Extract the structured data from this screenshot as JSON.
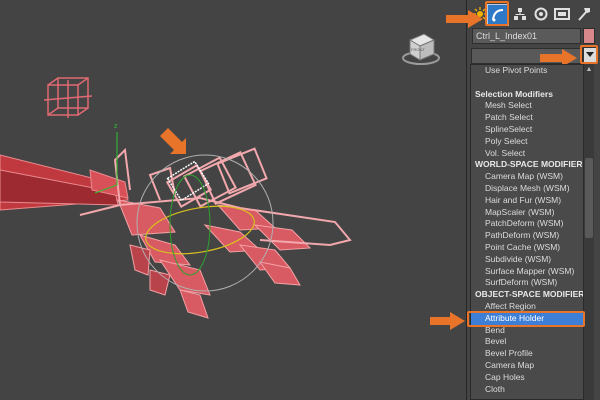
{
  "viewport": {
    "viewcube_label": "FRONT",
    "axis_z_label": "z"
  },
  "command_panel": {
    "tabs": [
      {
        "icon": "create-icon"
      },
      {
        "icon": "modify-icon"
      },
      {
        "icon": "hierarchy-icon"
      },
      {
        "icon": "motion-icon"
      },
      {
        "icon": "display-icon"
      },
      {
        "icon": "utilities-icon"
      }
    ],
    "object_name": "Ctrl_L_Index01",
    "object_color": "#d8888a"
  },
  "modifier_list": {
    "items": [
      {
        "type": "item",
        "label": "Use Pivot Points"
      },
      {
        "type": "blank",
        "label": ""
      },
      {
        "type": "header",
        "label": "Selection Modifiers"
      },
      {
        "type": "item",
        "label": "Mesh Select"
      },
      {
        "type": "item",
        "label": "Patch Select"
      },
      {
        "type": "item",
        "label": "SplineSelect"
      },
      {
        "type": "item",
        "label": "Poly Select"
      },
      {
        "type": "item",
        "label": "Vol. Select"
      },
      {
        "type": "header",
        "label": "WORLD-SPACE MODIFIERS"
      },
      {
        "type": "item",
        "label": "Camera Map (WSM)"
      },
      {
        "type": "item",
        "label": "Displace Mesh (WSM)"
      },
      {
        "type": "item",
        "label": "Hair and Fur (WSM)"
      },
      {
        "type": "item",
        "label": "MapScaler (WSM)"
      },
      {
        "type": "item",
        "label": "PatchDeform (WSM)"
      },
      {
        "type": "item",
        "label": "PathDeform (WSM)"
      },
      {
        "type": "item",
        "label": "Point Cache (WSM)"
      },
      {
        "type": "item",
        "label": "Subdivide (WSM)"
      },
      {
        "type": "item",
        "label": "Surface Mapper (WSM)"
      },
      {
        "type": "item",
        "label": "SurfDeform (WSM)"
      },
      {
        "type": "header",
        "label": "OBJECT-SPACE MODIFIERS"
      },
      {
        "type": "item",
        "label": "Affect Region"
      },
      {
        "type": "item",
        "label": "Attribute Holder",
        "selected": true
      },
      {
        "type": "item",
        "label": "Bend"
      },
      {
        "type": "item",
        "label": "Bevel"
      },
      {
        "type": "item",
        "label": "Bevel Profile"
      },
      {
        "type": "item",
        "label": "Camera Map"
      },
      {
        "type": "item",
        "label": "Cap Holes"
      },
      {
        "type": "item",
        "label": "Cloth"
      }
    ],
    "selection_color": "#3d7fd6"
  },
  "colors": {
    "accent_callout": "#e8742a",
    "viewport_bg": "#444444",
    "rig_wire": "#e06a72",
    "rig_fill": "#c84a52"
  }
}
